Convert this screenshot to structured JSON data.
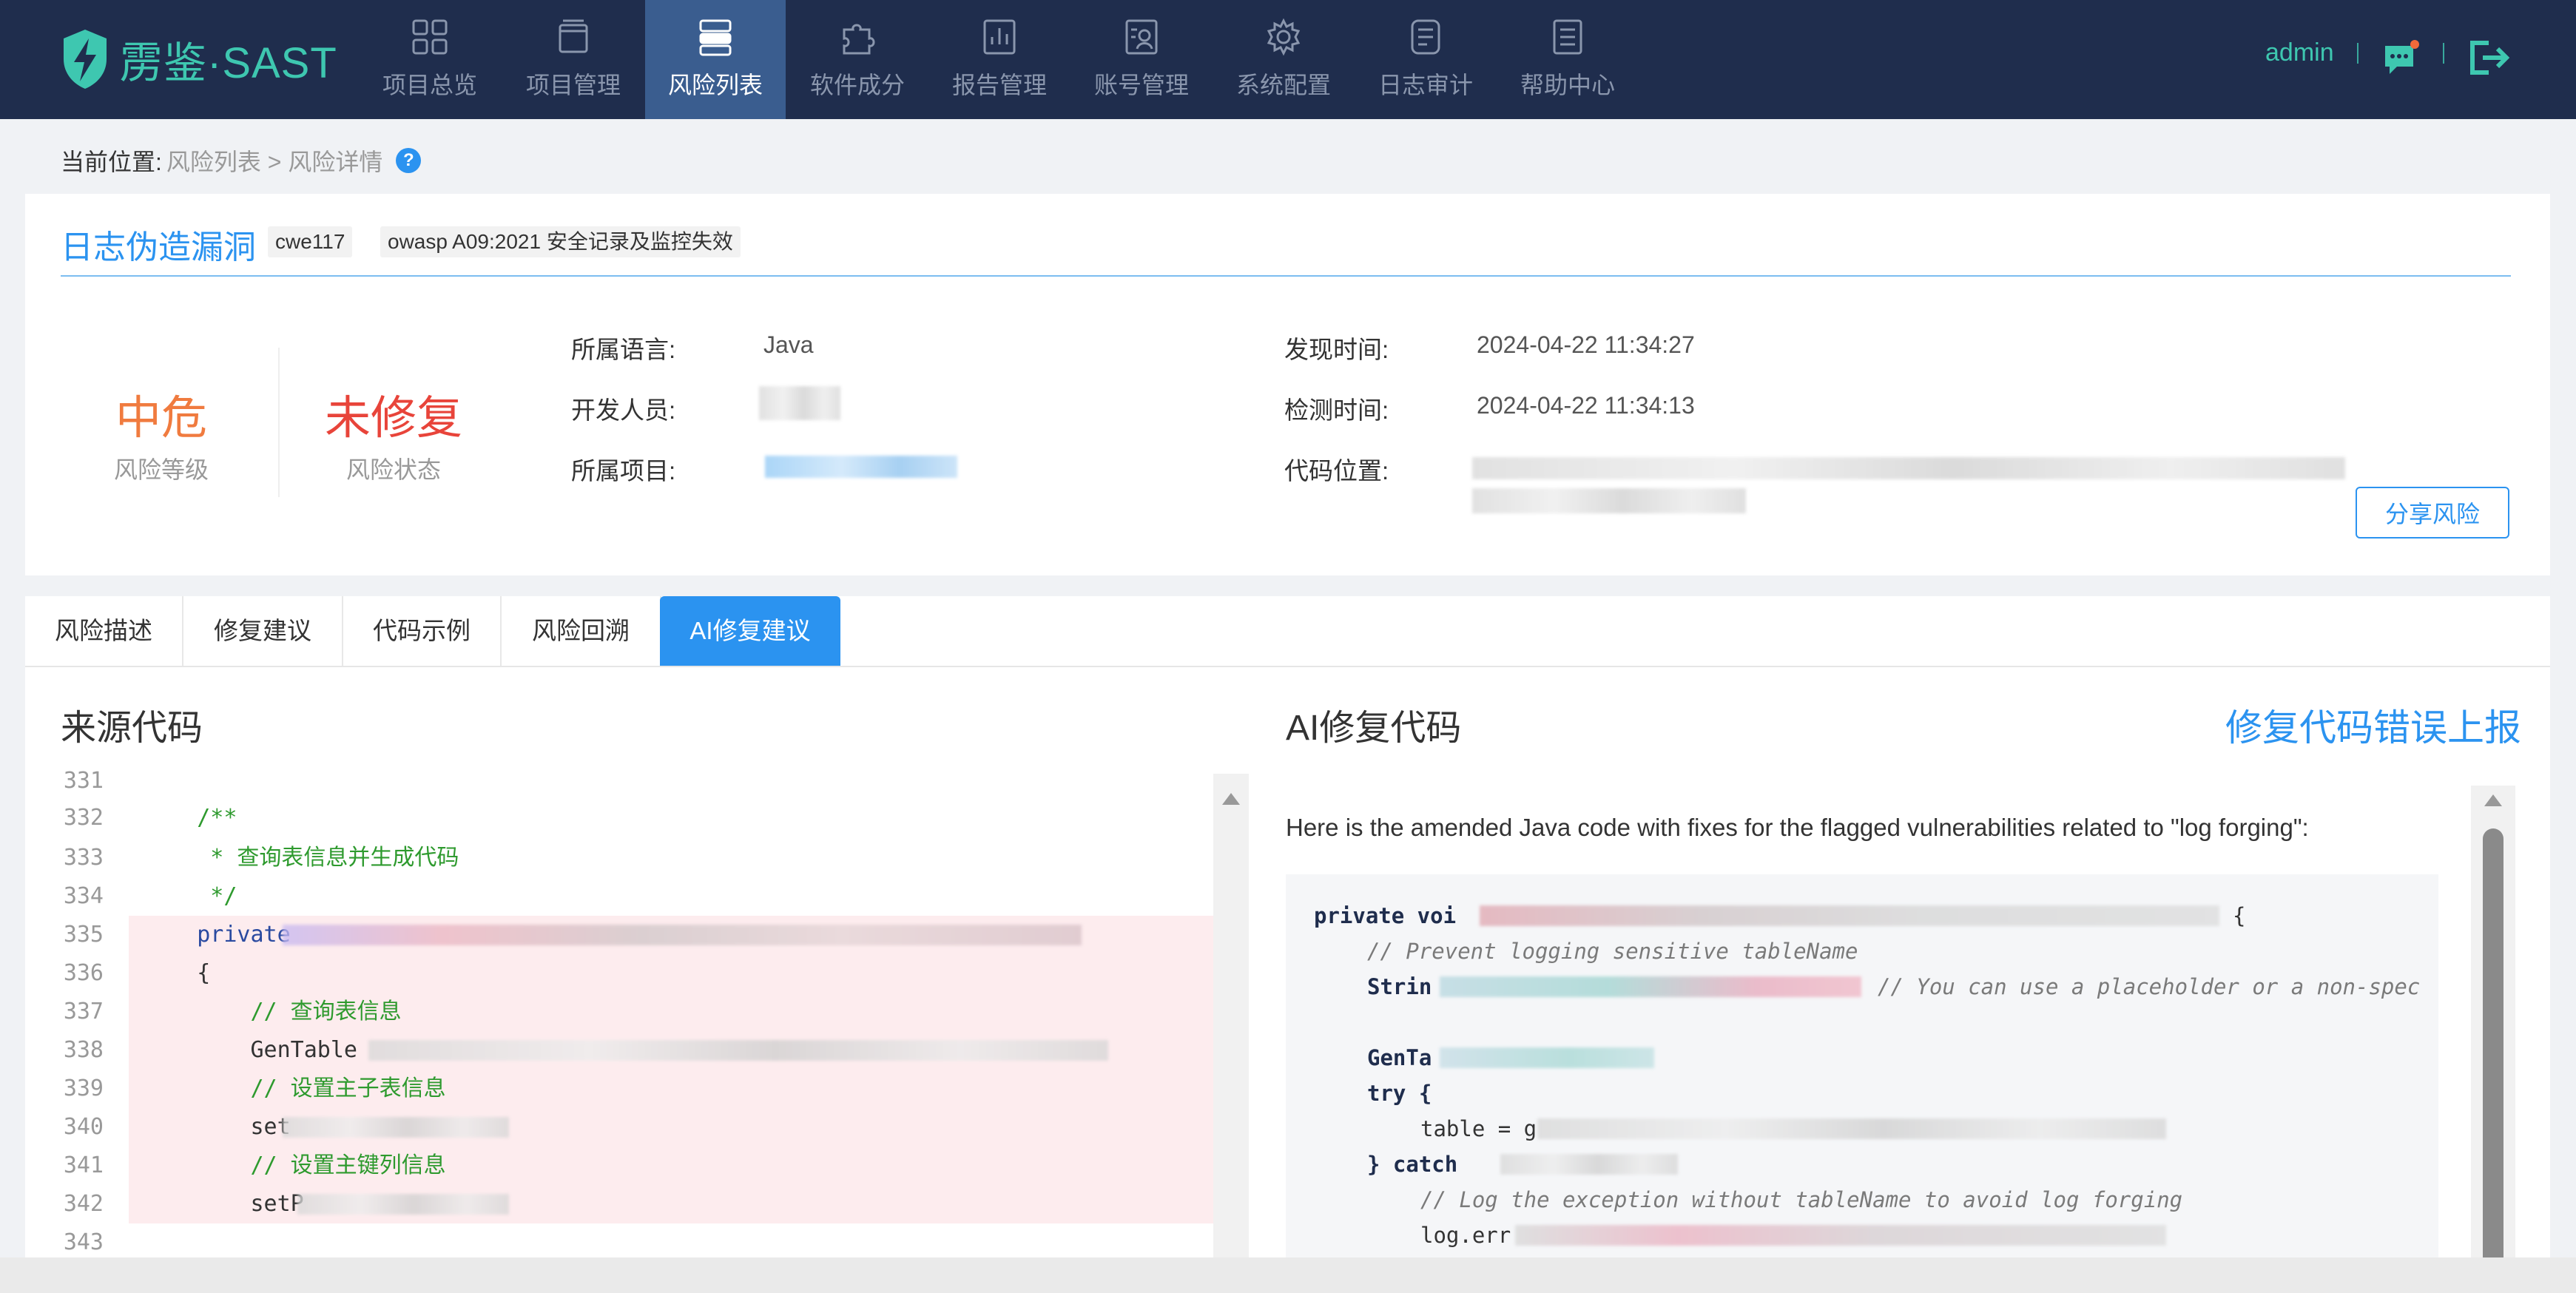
{
  "app": {
    "logo_text": "雳鉴·SAST"
  },
  "nav": {
    "items": [
      {
        "label": "项目总览",
        "icon": "grid-icon"
      },
      {
        "label": "项目管理",
        "icon": "folder-icon"
      },
      {
        "label": "风险列表",
        "icon": "server-icon",
        "active": true
      },
      {
        "label": "软件成分",
        "icon": "puzzle-icon"
      },
      {
        "label": "报告管理",
        "icon": "chart-icon"
      },
      {
        "label": "账号管理",
        "icon": "user-card-icon"
      },
      {
        "label": "系统配置",
        "icon": "gear-icon"
      },
      {
        "label": "日志审计",
        "icon": "log-icon"
      },
      {
        "label": "帮助中心",
        "icon": "doc-icon"
      }
    ],
    "user": "admin"
  },
  "breadcrumb": {
    "prefix": "当前位置:",
    "path": "风险列表 > 风险详情",
    "help": "?"
  },
  "vuln": {
    "title": "日志伪造漏洞",
    "tags": [
      "cwe117",
      "owasp A09:2021 安全记录及监控失效"
    ],
    "level_value": "中危",
    "level_label": "风险等级",
    "status_value": "未修复",
    "status_label": "风险状态",
    "fields": {
      "language_label": "所属语言:",
      "language_value": "Java",
      "developer_label": "开发人员:",
      "project_label": "所属项目:",
      "found_label": "发现时间:",
      "found_value": "2024-04-22 11:34:27",
      "detect_label": "检测时间:",
      "detect_value": "2024-04-22 11:34:13",
      "location_label": "代码位置:"
    },
    "share_button": "分享风险"
  },
  "tabs": [
    "风险描述",
    "修复建议",
    "代码示例",
    "风险回溯",
    "AI修复建议"
  ],
  "source": {
    "title": "来源代码",
    "lines": [
      {
        "n": "331",
        "text": ""
      },
      {
        "n": "332",
        "text": "    /**"
      },
      {
        "n": "333",
        "text": "     * 查询表信息并生成代码"
      },
      {
        "n": "334",
        "text": "     */"
      },
      {
        "n": "335",
        "text": "    private"
      },
      {
        "n": "336",
        "text": "    {"
      },
      {
        "n": "337",
        "text": "        // 查询表信息"
      },
      {
        "n": "338",
        "text": "        GenTable"
      },
      {
        "n": "339",
        "text": "        // 设置主子表信息"
      },
      {
        "n": "340",
        "text": "        set"
      },
      {
        "n": "341",
        "text": "        // 设置主键列信息"
      },
      {
        "n": "342",
        "text": "        setP"
      },
      {
        "n": "343",
        "text": ""
      }
    ]
  },
  "ai": {
    "title": "AI修复代码",
    "report_link": "修复代码错误上报",
    "intro": "Here is the amended Java code with fixes for the flagged vulnerabilities related to \"log forging\":",
    "code": {
      "l1": "private voi",
      "l1_tail": "{",
      "l2": "// Prevent logging sensitive tableName",
      "l3": "Strin",
      "l3_tail": "// You can use a placeholder or a non-spec",
      "l4": "GenTa",
      "l5": "try {",
      "l6": "table = g",
      "l7": "} catch",
      "l8": "// Log the exception without tableName to avoid log forging",
      "l9": "log.err"
    }
  }
}
